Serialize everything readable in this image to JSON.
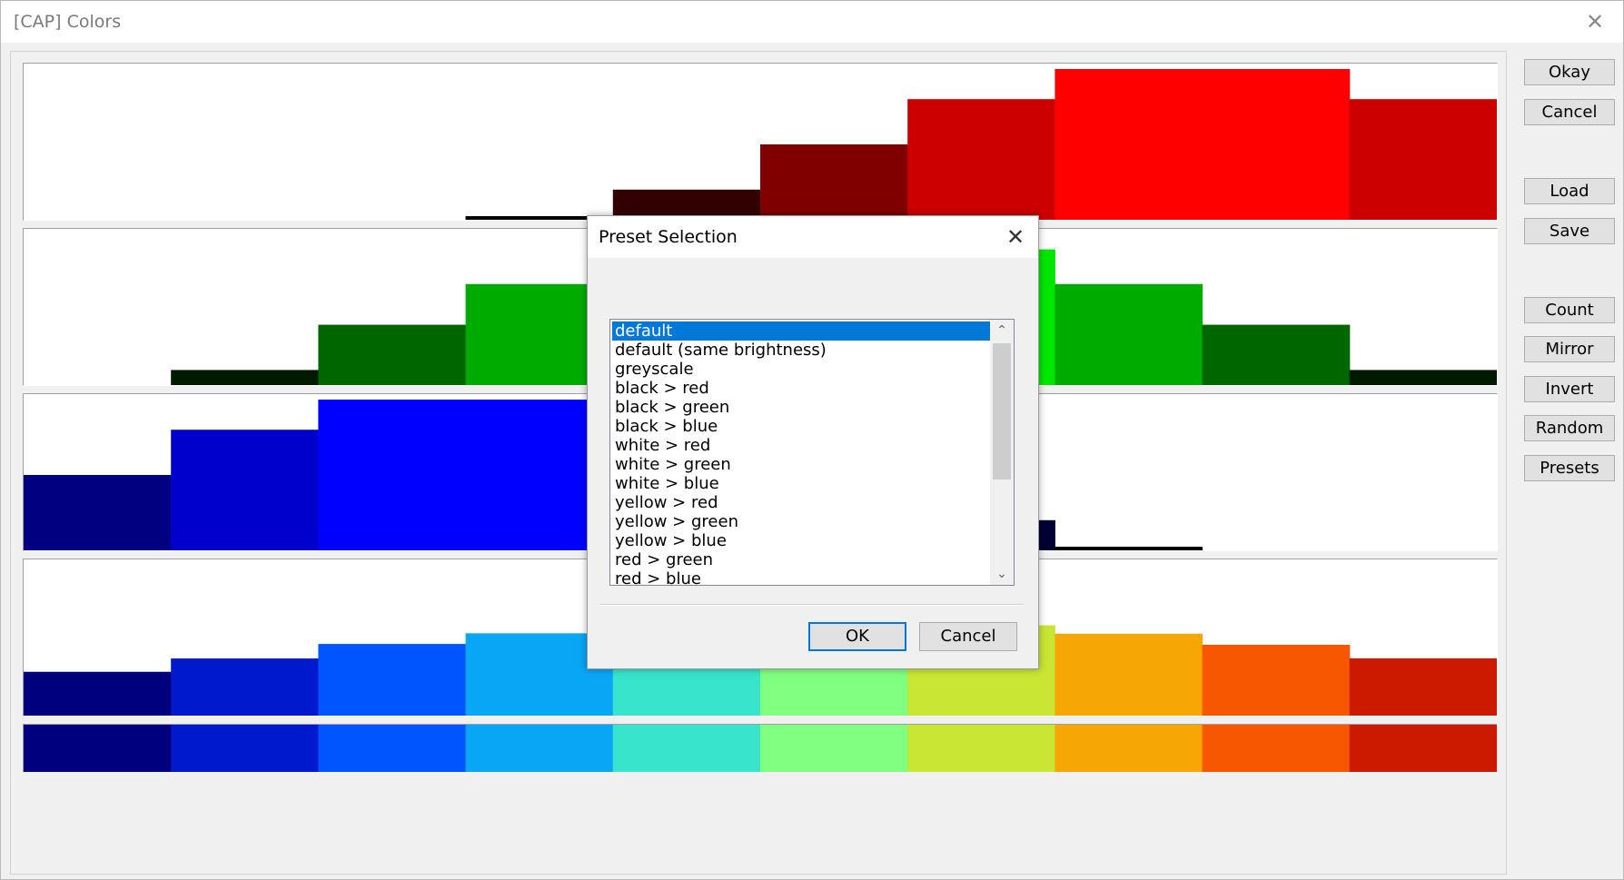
{
  "window": {
    "title": "[CAP] Colors",
    "close_glyph": "✕"
  },
  "sidebar": {
    "buttons": [
      {
        "label": "Okay"
      },
      {
        "label": "Cancel"
      },
      {
        "label": "Load"
      },
      {
        "label": "Save"
      },
      {
        "label": "Count"
      },
      {
        "label": "Mirror"
      },
      {
        "label": "Invert"
      },
      {
        "label": "Random"
      },
      {
        "label": "Presets"
      }
    ]
  },
  "channels": {
    "count": 10,
    "red": [
      0,
      0,
      0,
      0.02,
      0.2,
      0.5,
      0.8,
      1.0,
      1.0,
      0.8
    ],
    "green": [
      0,
      0.1,
      0.4,
      0.67,
      0.9,
      1.0,
      0.9,
      0.67,
      0.4,
      0.1
    ],
    "blue": [
      0.5,
      0.8,
      1.0,
      1.0,
      0.9,
      0.5,
      0.2,
      0.02,
      0,
      0
    ],
    "colors": [
      "#00007f",
      "#0019cc",
      "#0055ff",
      "#0aa6f6",
      "#39e4cc",
      "#80ff80",
      "#c9e634",
      "#f6a706",
      "#f75700",
      "#cc1a00"
    ]
  },
  "dialog": {
    "title": "Preset Selection",
    "close_glyph": "✕",
    "presets": [
      "default",
      "default (same brightness)",
      "greyscale",
      "black > red",
      "black > green",
      "black > blue",
      "white > red",
      "white > green",
      "white > blue",
      "yellow > red",
      "yellow > green",
      "yellow > blue",
      "red > green",
      "red > blue"
    ],
    "selected_index": 0,
    "ok_label": "OK",
    "cancel_label": "Cancel",
    "scroll_up_glyph": "⌃",
    "scroll_down_glyph": "⌄"
  }
}
